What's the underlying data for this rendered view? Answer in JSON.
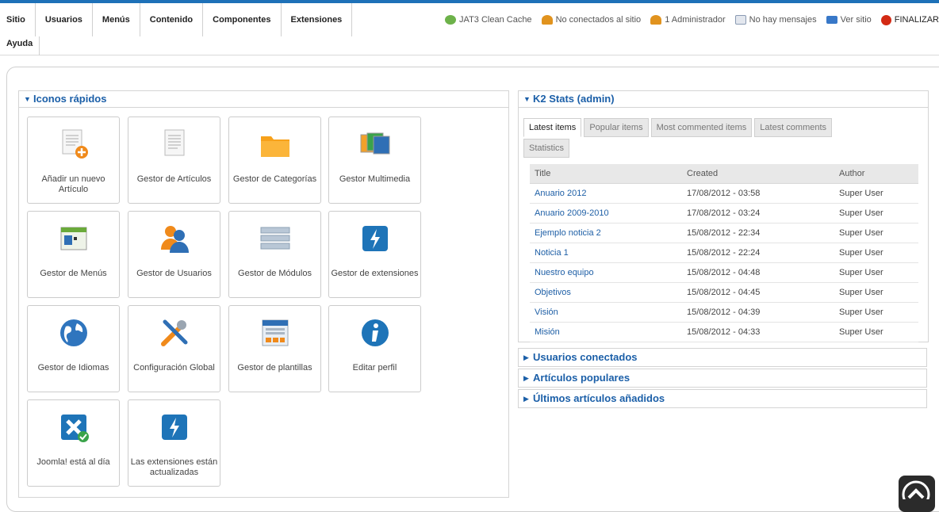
{
  "menu": {
    "items": [
      "Sitio",
      "Usuarios",
      "Menús",
      "Contenido",
      "Componentes",
      "Extensiones"
    ],
    "help": "Ayuda"
  },
  "status": {
    "jat_clean": "JAT3 Clean Cache",
    "users_online": "No conectados al sitio",
    "admins": "1 Administrador",
    "messages": "No hay mensajes",
    "view_site": "Ver sitio",
    "logout": "FINALIZAR"
  },
  "quick_icons": {
    "title": "Iconos rápidos",
    "items": [
      {
        "label": "Añadir un nuevo Artículo",
        "icon": "new-article-icon"
      },
      {
        "label": "Gestor de Artículos",
        "icon": "articles-icon"
      },
      {
        "label": "Gestor de Categorías",
        "icon": "folder-icon"
      },
      {
        "label": "Gestor Multimedia",
        "icon": "media-icon"
      },
      {
        "label": "Gestor de Menús",
        "icon": "menus-icon"
      },
      {
        "label": "Gestor de Usuarios",
        "icon": "users-icon"
      },
      {
        "label": "Gestor de Módulos",
        "icon": "modules-icon"
      },
      {
        "label": "Gestor de extensiones",
        "icon": "extensions-icon"
      },
      {
        "label": "Gestor de Idiomas",
        "icon": "globe-icon"
      },
      {
        "label": "Configuración Global",
        "icon": "tools-icon"
      },
      {
        "label": "Gestor de plantillas",
        "icon": "templates-icon"
      },
      {
        "label": "Editar perfil",
        "icon": "info-icon"
      },
      {
        "label": "Joomla! está al día",
        "icon": "joomla-check-icon"
      },
      {
        "label": "Las extensiones están actualizadas",
        "icon": "extensions-update-icon"
      }
    ]
  },
  "k2": {
    "title": "K2 Stats (admin)",
    "tabs": [
      "Latest items",
      "Popular items",
      "Most commented items",
      "Latest comments",
      "Statistics"
    ],
    "columns": [
      "Title",
      "Created",
      "Author"
    ],
    "rows": [
      [
        "Anuario 2012",
        "17/08/2012 - 03:58",
        "Super User"
      ],
      [
        "Anuario 2009-2010",
        "17/08/2012 - 03:24",
        "Super User"
      ],
      [
        "Ejemplo noticia 2",
        "15/08/2012 - 22:34",
        "Super User"
      ],
      [
        "Noticia 1",
        "15/08/2012 - 22:24",
        "Super User"
      ],
      [
        "Nuestro equipo",
        "15/08/2012 - 04:48",
        "Super User"
      ],
      [
        "Objetivos",
        "15/08/2012 - 04:45",
        "Super User"
      ],
      [
        "Visión",
        "15/08/2012 - 04:39",
        "Super User"
      ],
      [
        "Misión",
        "15/08/2012 - 04:33",
        "Super User"
      ]
    ]
  },
  "collapsed_panels": [
    "Usuarios conectados",
    "Artículos populares",
    "Últimos artículos añadidos"
  ]
}
